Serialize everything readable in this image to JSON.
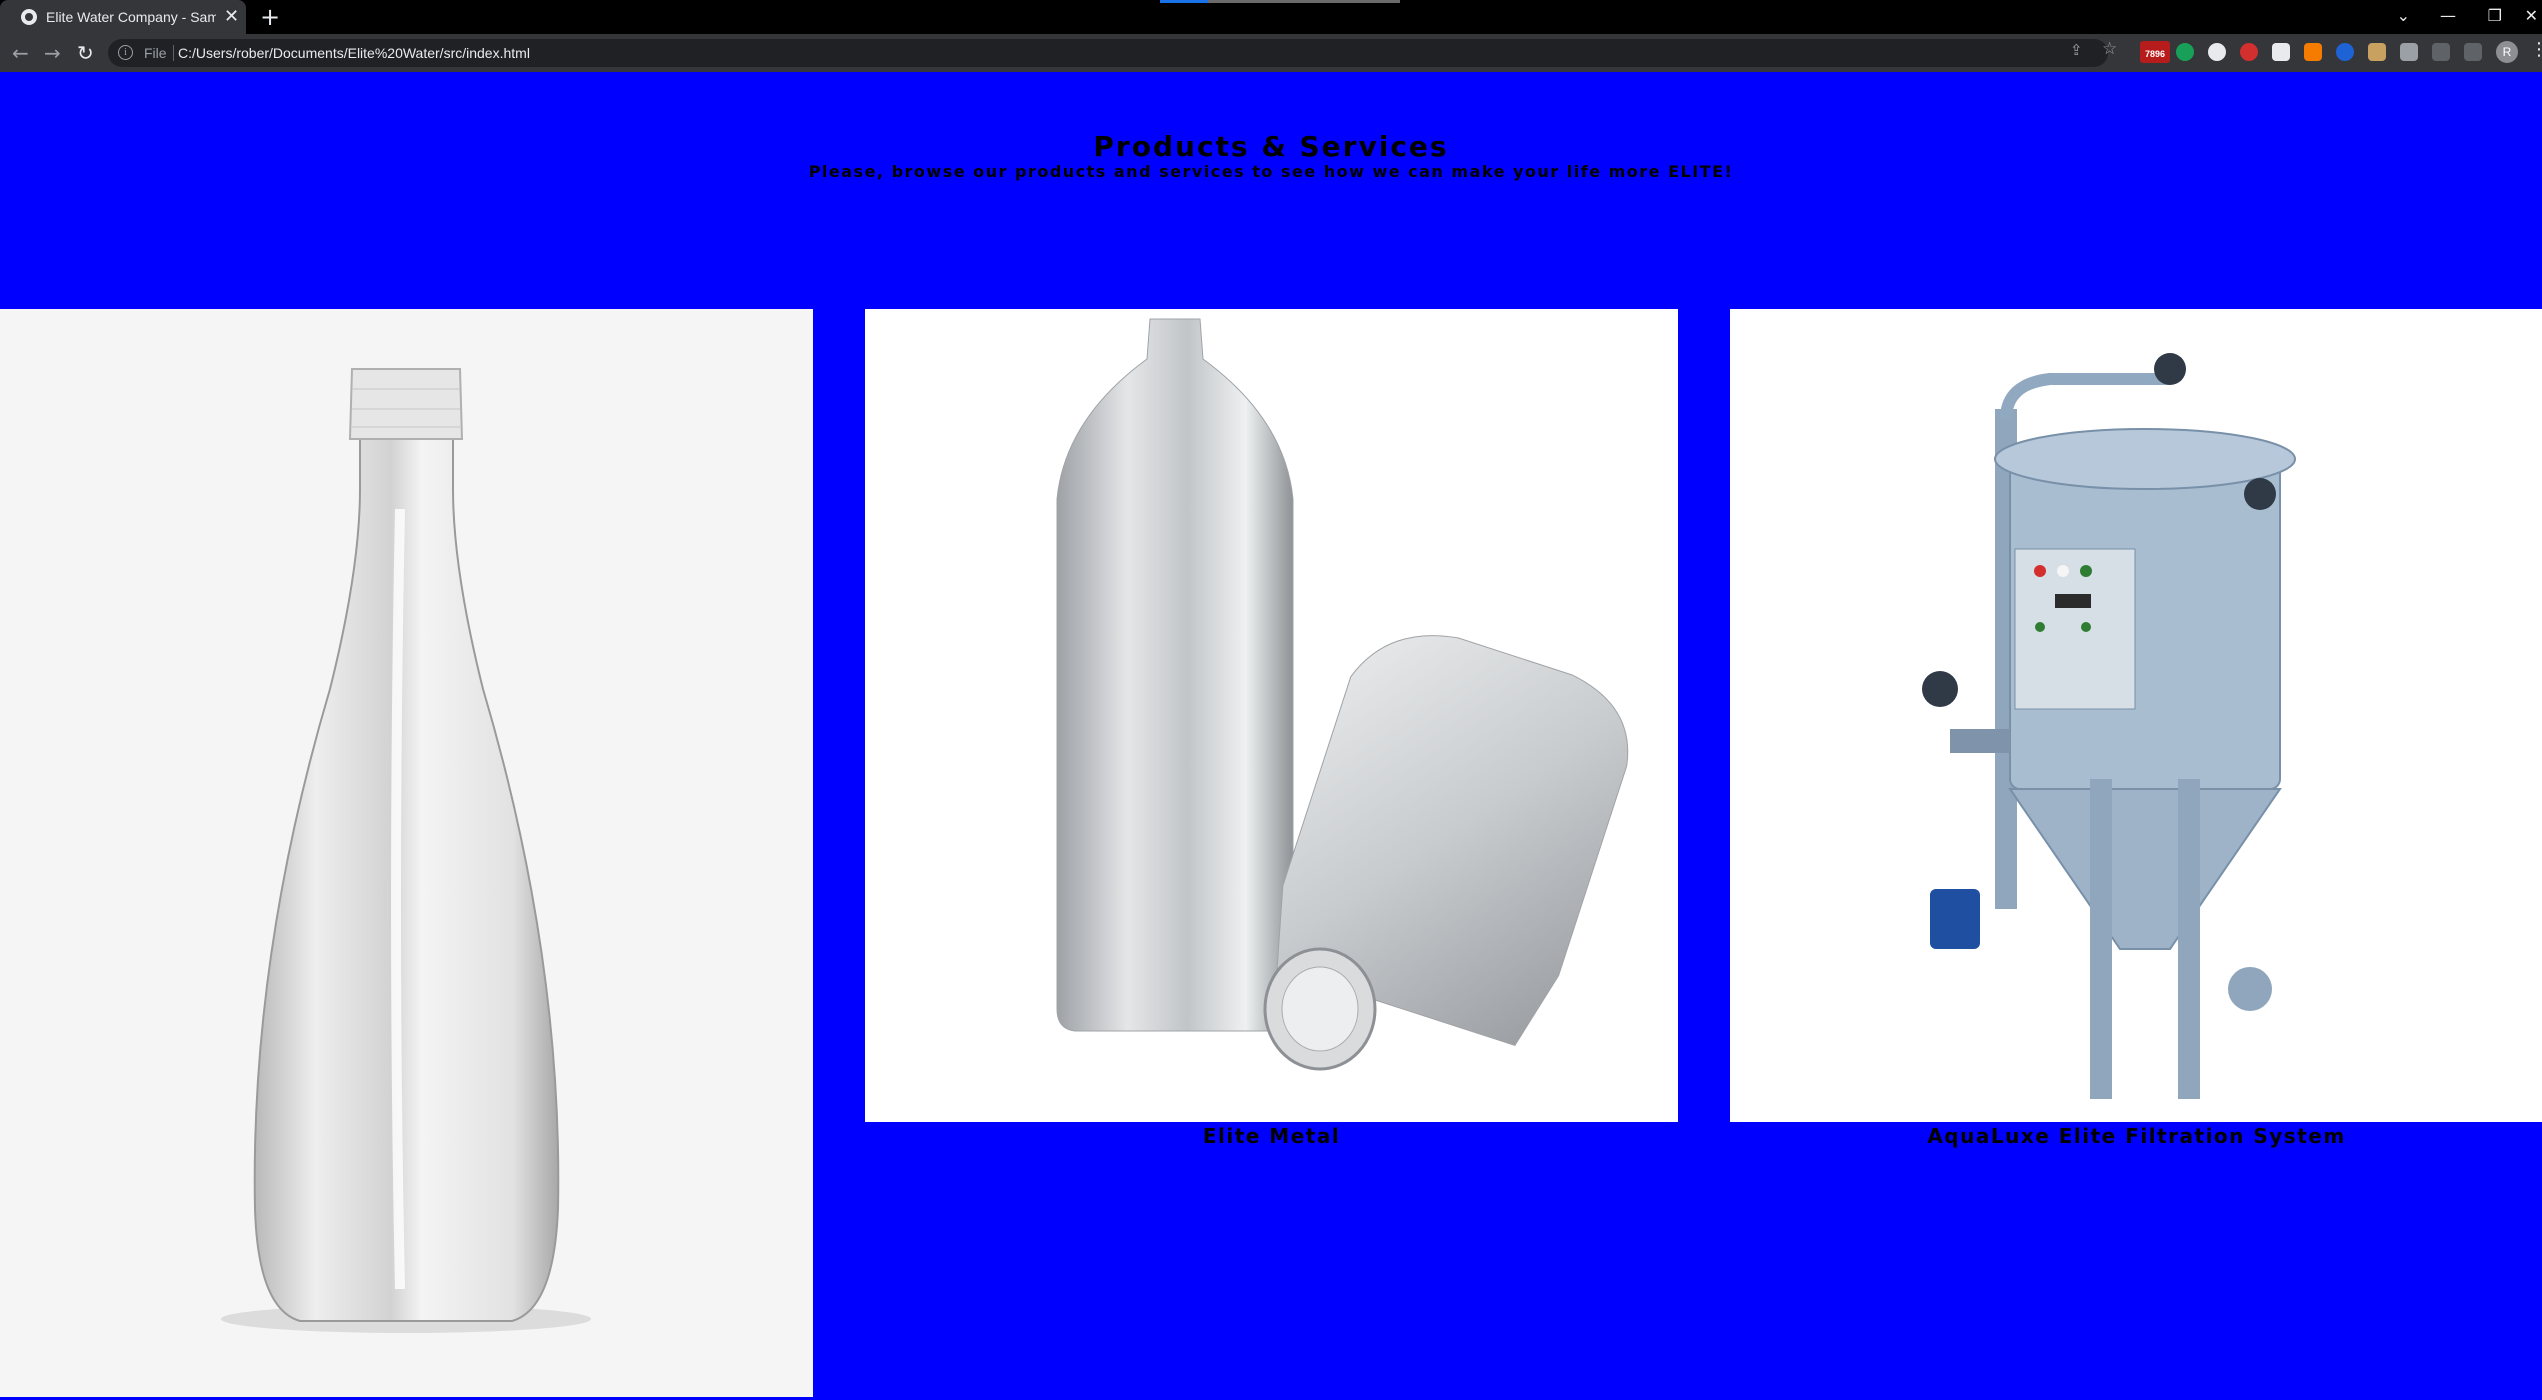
{
  "browser": {
    "tab_title": "Elite Water Company - Sample Si",
    "new_tab": "+",
    "close": "✕",
    "scheme_label": "File",
    "url": "C:/Users/rober/Documents/Elite%20Water/src/index.html",
    "extension_badge": "7896",
    "profile_initial": "R"
  },
  "page": {
    "heading": "Products & Services",
    "subheading": "Please, browse our products and services to see how we can make your life more ELITE!"
  },
  "products": [
    {
      "caption": "",
      "image": "glass-water-bottle"
    },
    {
      "caption": "Elite Metal",
      "image": "aluminum-bottles"
    },
    {
      "caption": "AquaLuxe Elite Filtration System",
      "image": "industrial-filtration-tank"
    }
  ],
  "colors": {
    "page_background": "#0000ff",
    "text": "#000000",
    "chrome_dark": "#35363a",
    "tabstrip": "#000000"
  }
}
